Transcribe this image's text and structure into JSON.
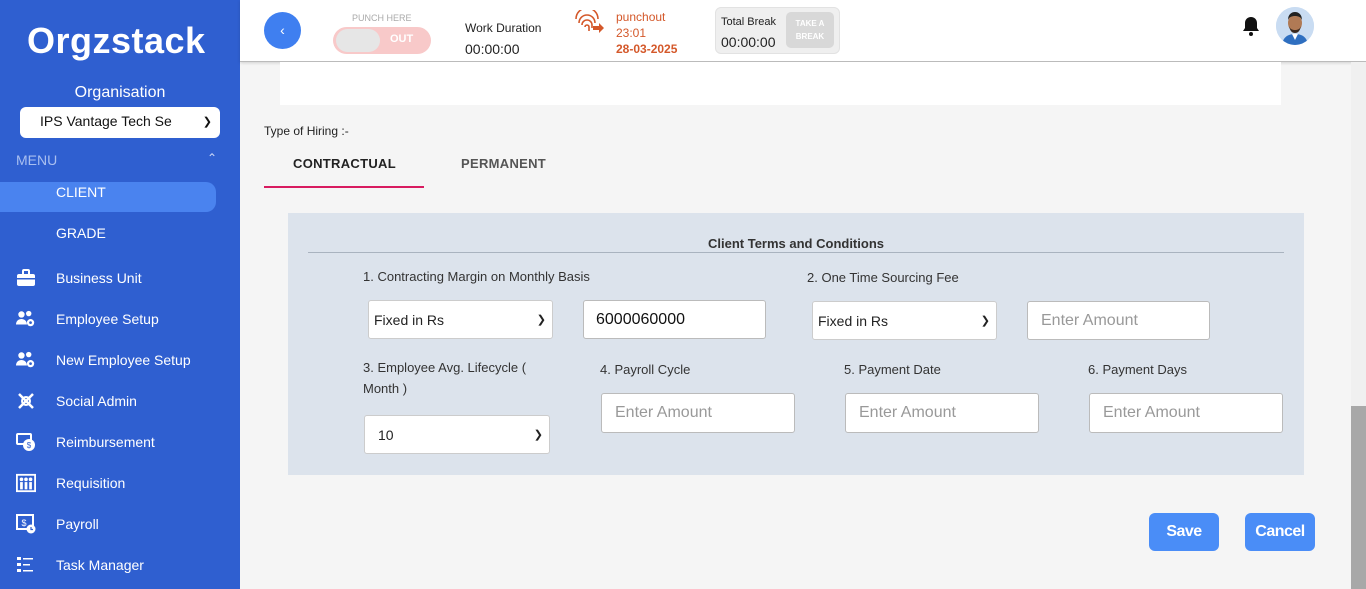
{
  "brand": {
    "logo_text": "Orgzstack",
    "accent": "#2f5fd0"
  },
  "sidebar": {
    "org_label": "Organisation",
    "org_value": "IPS Vantage Tech Se",
    "menu_label": "MENU",
    "items": [
      {
        "label": "CLIENT",
        "icon": "none",
        "active": true
      },
      {
        "label": "GRADE",
        "icon": "none"
      },
      {
        "label": "Business Unit",
        "icon": "briefcase-icon"
      },
      {
        "label": "Employee Setup",
        "icon": "users-gear-icon"
      },
      {
        "label": "New Employee Setup",
        "icon": "users-gear-icon"
      },
      {
        "label": "Social Admin",
        "icon": "social-icon"
      },
      {
        "label": "Reimbursement",
        "icon": "money-icon"
      },
      {
        "label": "Requisition",
        "icon": "people-icon"
      },
      {
        "label": "Payroll",
        "icon": "payroll-icon"
      },
      {
        "label": "Task Manager",
        "icon": "list-icon"
      }
    ]
  },
  "topbar": {
    "back_icon": "chevron-left-icon",
    "punch_here_label": "PUNCH HERE",
    "punch_toggle_label": "OUT",
    "work_duration_label": "Work Duration",
    "work_duration_value": "00:00:00",
    "punchout_label": "punchout",
    "punchout_time": "23:01",
    "punchout_date": "28-03-2025",
    "total_break_label": "Total Break",
    "total_break_value": "00:00:00",
    "take_break_label": "TAKE A BREAK"
  },
  "main": {
    "hiring_label": "Type of Hiring :-",
    "tabs": [
      {
        "label": "CONTRACTUAL",
        "active": true
      },
      {
        "label": "PERMANENT"
      }
    ],
    "terms": {
      "title": "Client Terms and Conditions",
      "q1_label": "1. Contracting Margin on Monthly Basis",
      "q1_select": "Fixed in Rs",
      "q1_value": "6000060000",
      "q2_label": "2. One Time Sourcing Fee",
      "q2_select": "Fixed in Rs",
      "q2_placeholder": "Enter Amount",
      "q3_label": "3. Employee Avg. Lifecycle ( Month )",
      "q3_select": "10",
      "q4_label": "4. Payroll Cycle",
      "q4_placeholder": "Enter Amount",
      "q5_label": "5. Payment Date",
      "q5_placeholder": "Enter Amount",
      "q6_label": "6. Payment Days",
      "q6_placeholder": "Enter Amount"
    },
    "save_label": "Save",
    "cancel_label": "Cancel"
  }
}
